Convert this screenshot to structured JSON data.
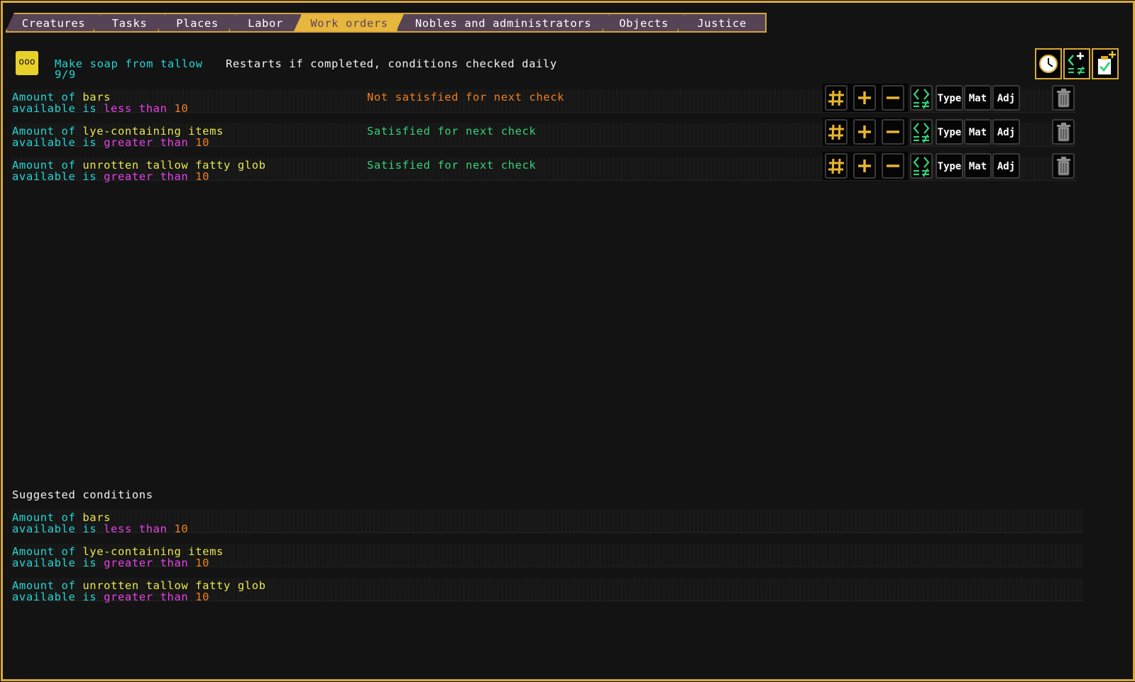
{
  "tabs": [
    {
      "label": "Creatures",
      "active": false
    },
    {
      "label": "Tasks",
      "active": false
    },
    {
      "label": "Places",
      "active": false
    },
    {
      "label": "Labor",
      "active": false
    },
    {
      "label": "Work orders",
      "active": true
    },
    {
      "label": "Nobles and administrators",
      "active": false
    },
    {
      "label": "Objects",
      "active": false
    },
    {
      "label": "Justice",
      "active": false
    }
  ],
  "order": {
    "icon_text": "ooo",
    "name": "Make soap from tallow",
    "count": "9/9",
    "repeat_info": "Restarts if completed, conditions checked daily"
  },
  "top_buttons": [
    {
      "icon": "clock-icon"
    },
    {
      "icon": "add-condition-icon"
    },
    {
      "icon": "add-order-clipboard-icon"
    }
  ],
  "conditions": [
    {
      "prefix": "Amount of",
      "item": "bars",
      "line2_prefix": "available is",
      "comparison": "less than",
      "value": "10",
      "status": "Not satisfied for next check",
      "status_ok": false
    },
    {
      "prefix": "Amount of",
      "item": "lye-containing items",
      "line2_prefix": "available is",
      "comparison": "greater than",
      "value": "10",
      "status": "Satisfied for next check",
      "status_ok": true
    },
    {
      "prefix": "Amount of",
      "item": "unrotten tallow fatty glob",
      "line2_prefix": "available is",
      "comparison": "greater than",
      "value": "10",
      "status": "Satisfied for next check",
      "status_ok": true
    }
  ],
  "condition_buttons": {
    "type": "Type",
    "mat": "Mat",
    "adj": "Adj"
  },
  "suggested": {
    "heading": "Suggested conditions",
    "items": [
      {
        "prefix": "Amount of",
        "item": "bars",
        "line2_prefix": "available is",
        "comparison": "less than",
        "value": "10"
      },
      {
        "prefix": "Amount of",
        "item": "lye-containing items",
        "line2_prefix": "available is",
        "comparison": "greater than",
        "value": "10"
      },
      {
        "prefix": "Amount of",
        "item": "unrotten tallow fatty glob",
        "line2_prefix": "available is",
        "comparison": "greater than",
        "value": "10"
      }
    ]
  },
  "colors": {
    "frame": "#d9a933",
    "cyan": "#25d4d4",
    "yellow": "#e9e64e",
    "magenta": "#e641e6",
    "orange": "#f07f1c",
    "green": "#35d27a"
  }
}
